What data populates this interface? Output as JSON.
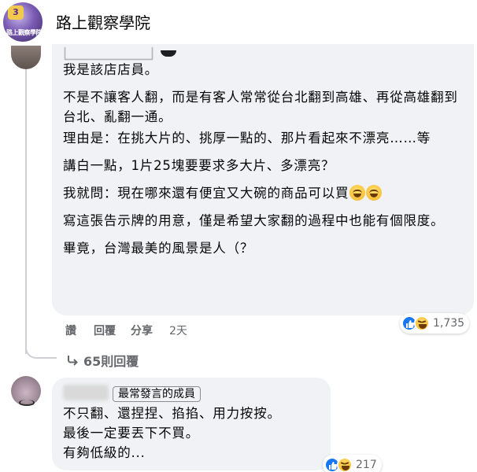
{
  "group": {
    "name": "路上觀察學院",
    "avatar_badge": "3",
    "avatar_caption": "路上觀察學院"
  },
  "comment1": {
    "lines": [
      "我是該店店員。",
      "不是不讓客人翻，而是有客人常常從台北翻到高雄、再從高雄翻到台北、亂翻一通。",
      "理由是：在挑大片的、挑厚一點的、那片看起來不漂亮……等",
      "講白一點，1片25塊要要求多大片、多漂亮？",
      "我就問：現在哪來還有便宜又大碗的商品可以買",
      "寫這張告示牌的用意，僅是希望大家翻的過程中也能有個限度。",
      "畢竟，台灣最美的風景是人（？"
    ],
    "actions": {
      "like": "讚",
      "reply": "回覆",
      "share": "分享",
      "time": "2天"
    },
    "reaction_count": "1,735",
    "reaction_types": [
      "like",
      "haha"
    ]
  },
  "replies": {
    "label": "65則回覆",
    "icon": "reply-arrow-icon"
  },
  "comment2": {
    "badge": "最常發言的成員",
    "lines": [
      "不只翻、還捏捏、掐掐、用力按按。",
      "最後一定要丟下不買。",
      "有夠低級的..."
    ],
    "reaction_count": "217",
    "reaction_types": [
      "like",
      "haha"
    ]
  },
  "colors": {
    "bubble": "#f0f2f5",
    "secondary_text": "#65676b",
    "like_blue": "#1877f2",
    "thread_line": "#ced0d4"
  }
}
